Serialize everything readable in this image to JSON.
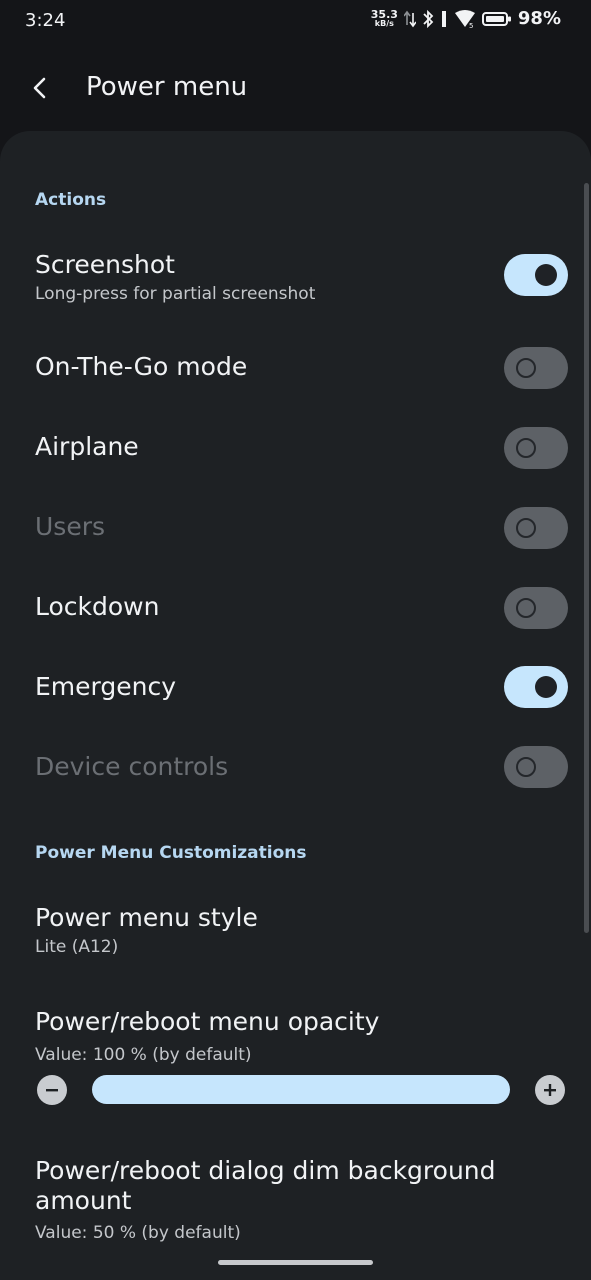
{
  "status_bar": {
    "time": "3:24",
    "net_speed_value": "35.3",
    "net_speed_unit": "kB/s",
    "battery_percent": "98%"
  },
  "header": {
    "title": "Power menu",
    "back_icon": "back-arrow-icon"
  },
  "sections": {
    "actions": "Actions",
    "customizations": "Power Menu Customizations"
  },
  "actions": [
    {
      "title": "Screenshot",
      "subtitle": "Long-press for partial screenshot",
      "enabled": true,
      "checked": true
    },
    {
      "title": "On-The-Go mode",
      "enabled": true,
      "checked": false
    },
    {
      "title": "Airplane",
      "enabled": true,
      "checked": false
    },
    {
      "title": "Users",
      "enabled": false,
      "checked": false
    },
    {
      "title": "Lockdown",
      "enabled": true,
      "checked": false
    },
    {
      "title": "Emergency",
      "enabled": true,
      "checked": true
    },
    {
      "title": "Device controls",
      "enabled": false,
      "checked": false
    }
  ],
  "customizations": {
    "style": {
      "title": "Power menu style",
      "value": "Lite (A12)"
    },
    "opacity": {
      "title": "Power/reboot menu opacity",
      "value_text": "Value: 100 % (by default)",
      "percent": 100
    },
    "dim": {
      "title": "Power/reboot dialog dim background amount",
      "value_text": "Value: 50 % (by default)"
    }
  },
  "colors": {
    "accent": "#c6e6fd",
    "background": "#141518",
    "panel": "#1e2124"
  }
}
